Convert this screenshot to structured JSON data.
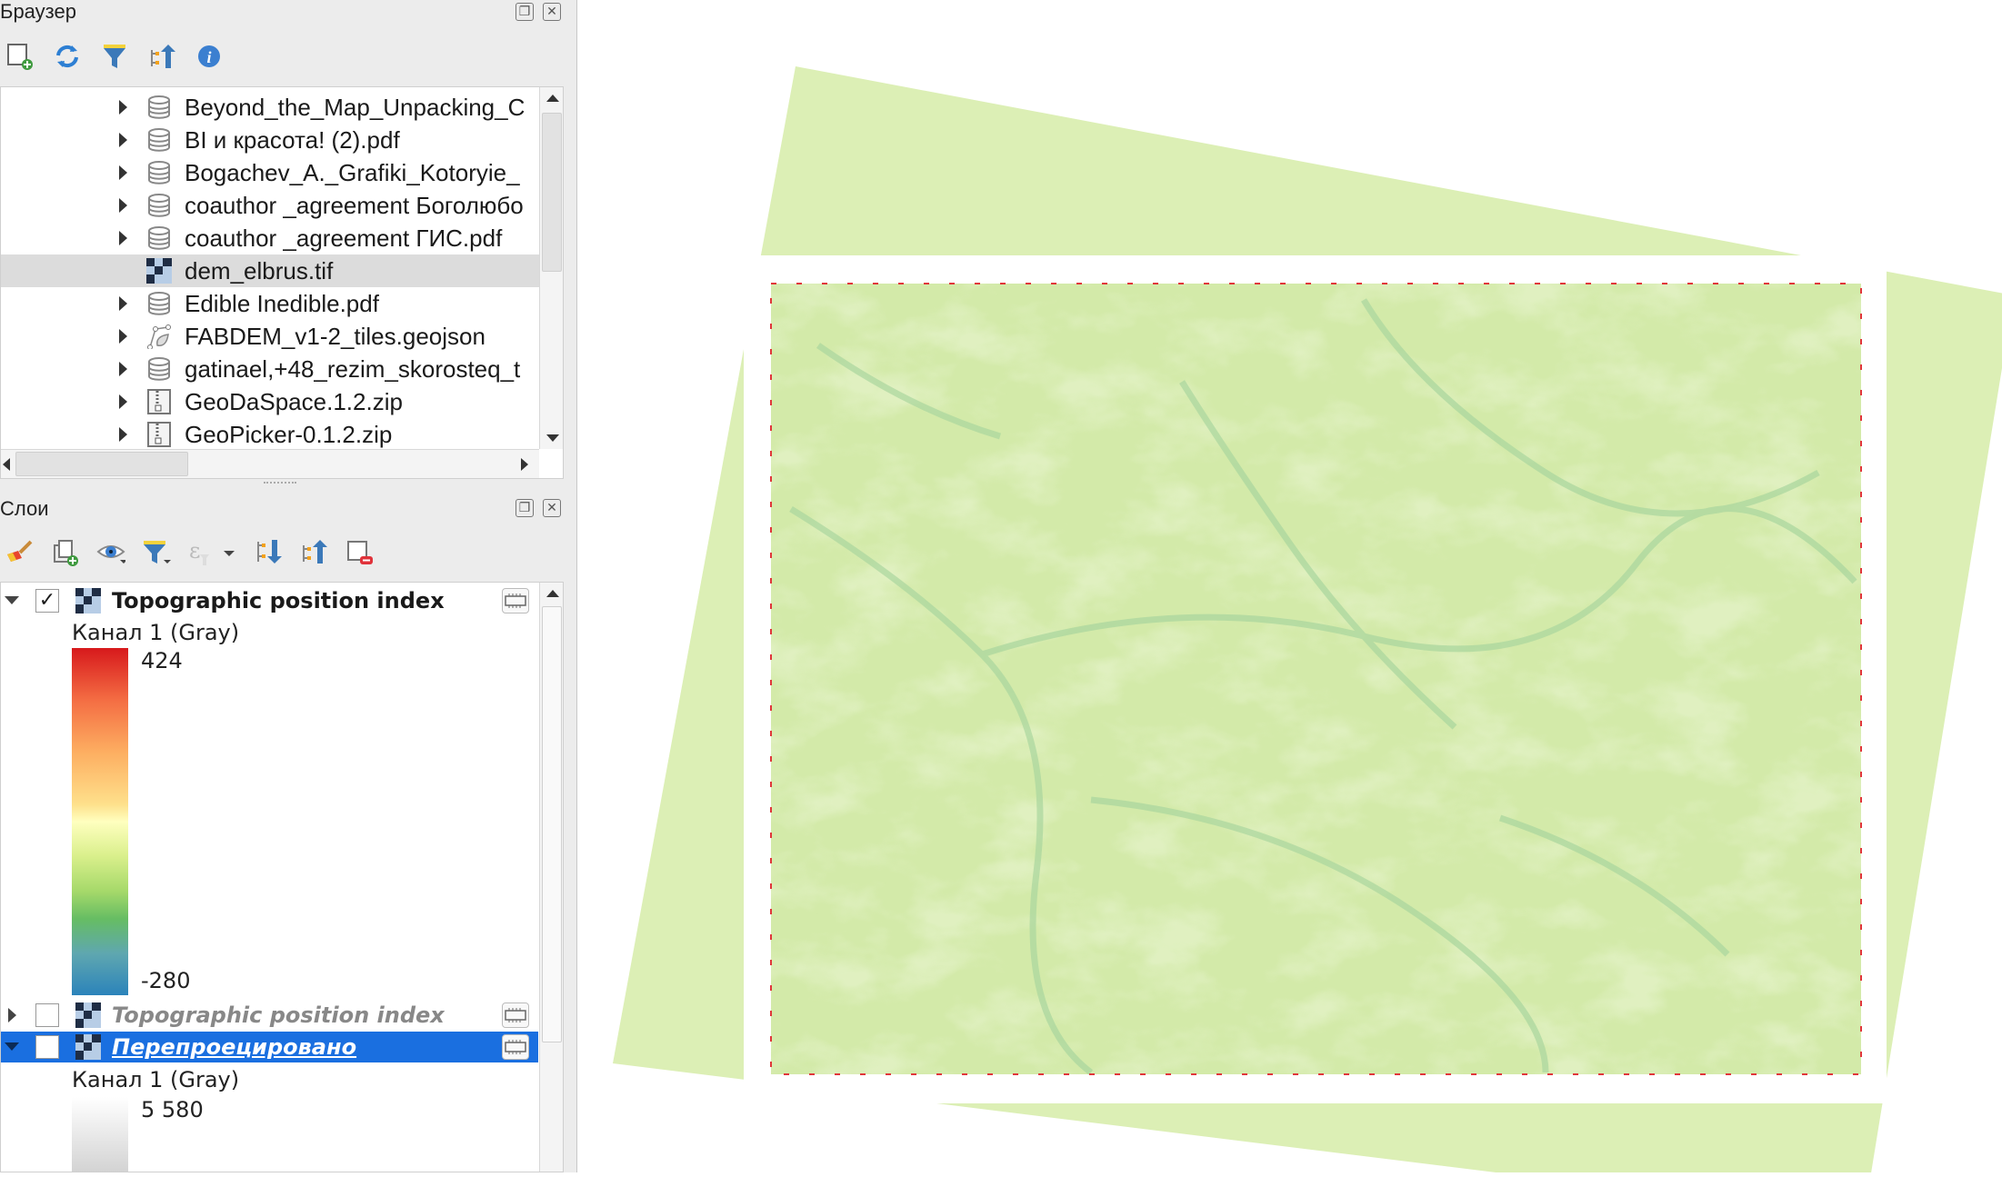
{
  "browser_panel": {
    "title": "Браузер",
    "toolbar": [
      "add-layer-icon",
      "refresh-icon",
      "filter-icon",
      "collapse-icon",
      "info-icon"
    ],
    "items": [
      {
        "label": "Beyond_the_Map_Unpacking_C",
        "icon": "database-icon",
        "expandable": true
      },
      {
        "label": "BI и красота! (2).pdf",
        "icon": "database-icon",
        "expandable": true
      },
      {
        "label": "Bogachev_A._Grafiki_Kotoryie_",
        "icon": "database-icon",
        "expandable": true
      },
      {
        "label": "coauthor _agreement Боголюбо",
        "icon": "database-icon",
        "expandable": true
      },
      {
        "label": "coauthor _agreement ГИС.pdf",
        "icon": "database-icon",
        "expandable": true
      },
      {
        "label": "dem_elbrus.tif",
        "icon": "raster-icon",
        "expandable": false,
        "selected": true
      },
      {
        "label": "Edible Inedible.pdf",
        "icon": "database-icon",
        "expandable": true
      },
      {
        "label": "FABDEM_v1-2_tiles.geojson",
        "icon": "vector-icon",
        "expandable": true
      },
      {
        "label": "gatinael,+48_rezim_skorosteq_t",
        "icon": "database-icon",
        "expandable": true
      },
      {
        "label": "GeoDaSpace.1.2.zip",
        "icon": "zip-icon",
        "expandable": true
      },
      {
        "label": "GeoPicker-0.1.2.zip",
        "icon": "zip-icon",
        "expandable": true
      }
    ]
  },
  "layers_panel": {
    "title": "Слои",
    "layers": [
      {
        "name": "Topographic position index",
        "checked": true,
        "expanded": true,
        "band": "Канал 1 (Gray)",
        "max": "424",
        "min": "-280"
      },
      {
        "name": "Topographic position index",
        "checked": false,
        "expanded": false
      },
      {
        "name": "Перепроецировано",
        "checked": false,
        "expanded": true,
        "selected": true,
        "band": "Канал 1 (Gray)",
        "max": "5 580"
      }
    ]
  },
  "colors": {
    "accent": "#1a6fe0",
    "map_green": "#dcefb5",
    "raster_base": "#d3eaa9"
  }
}
